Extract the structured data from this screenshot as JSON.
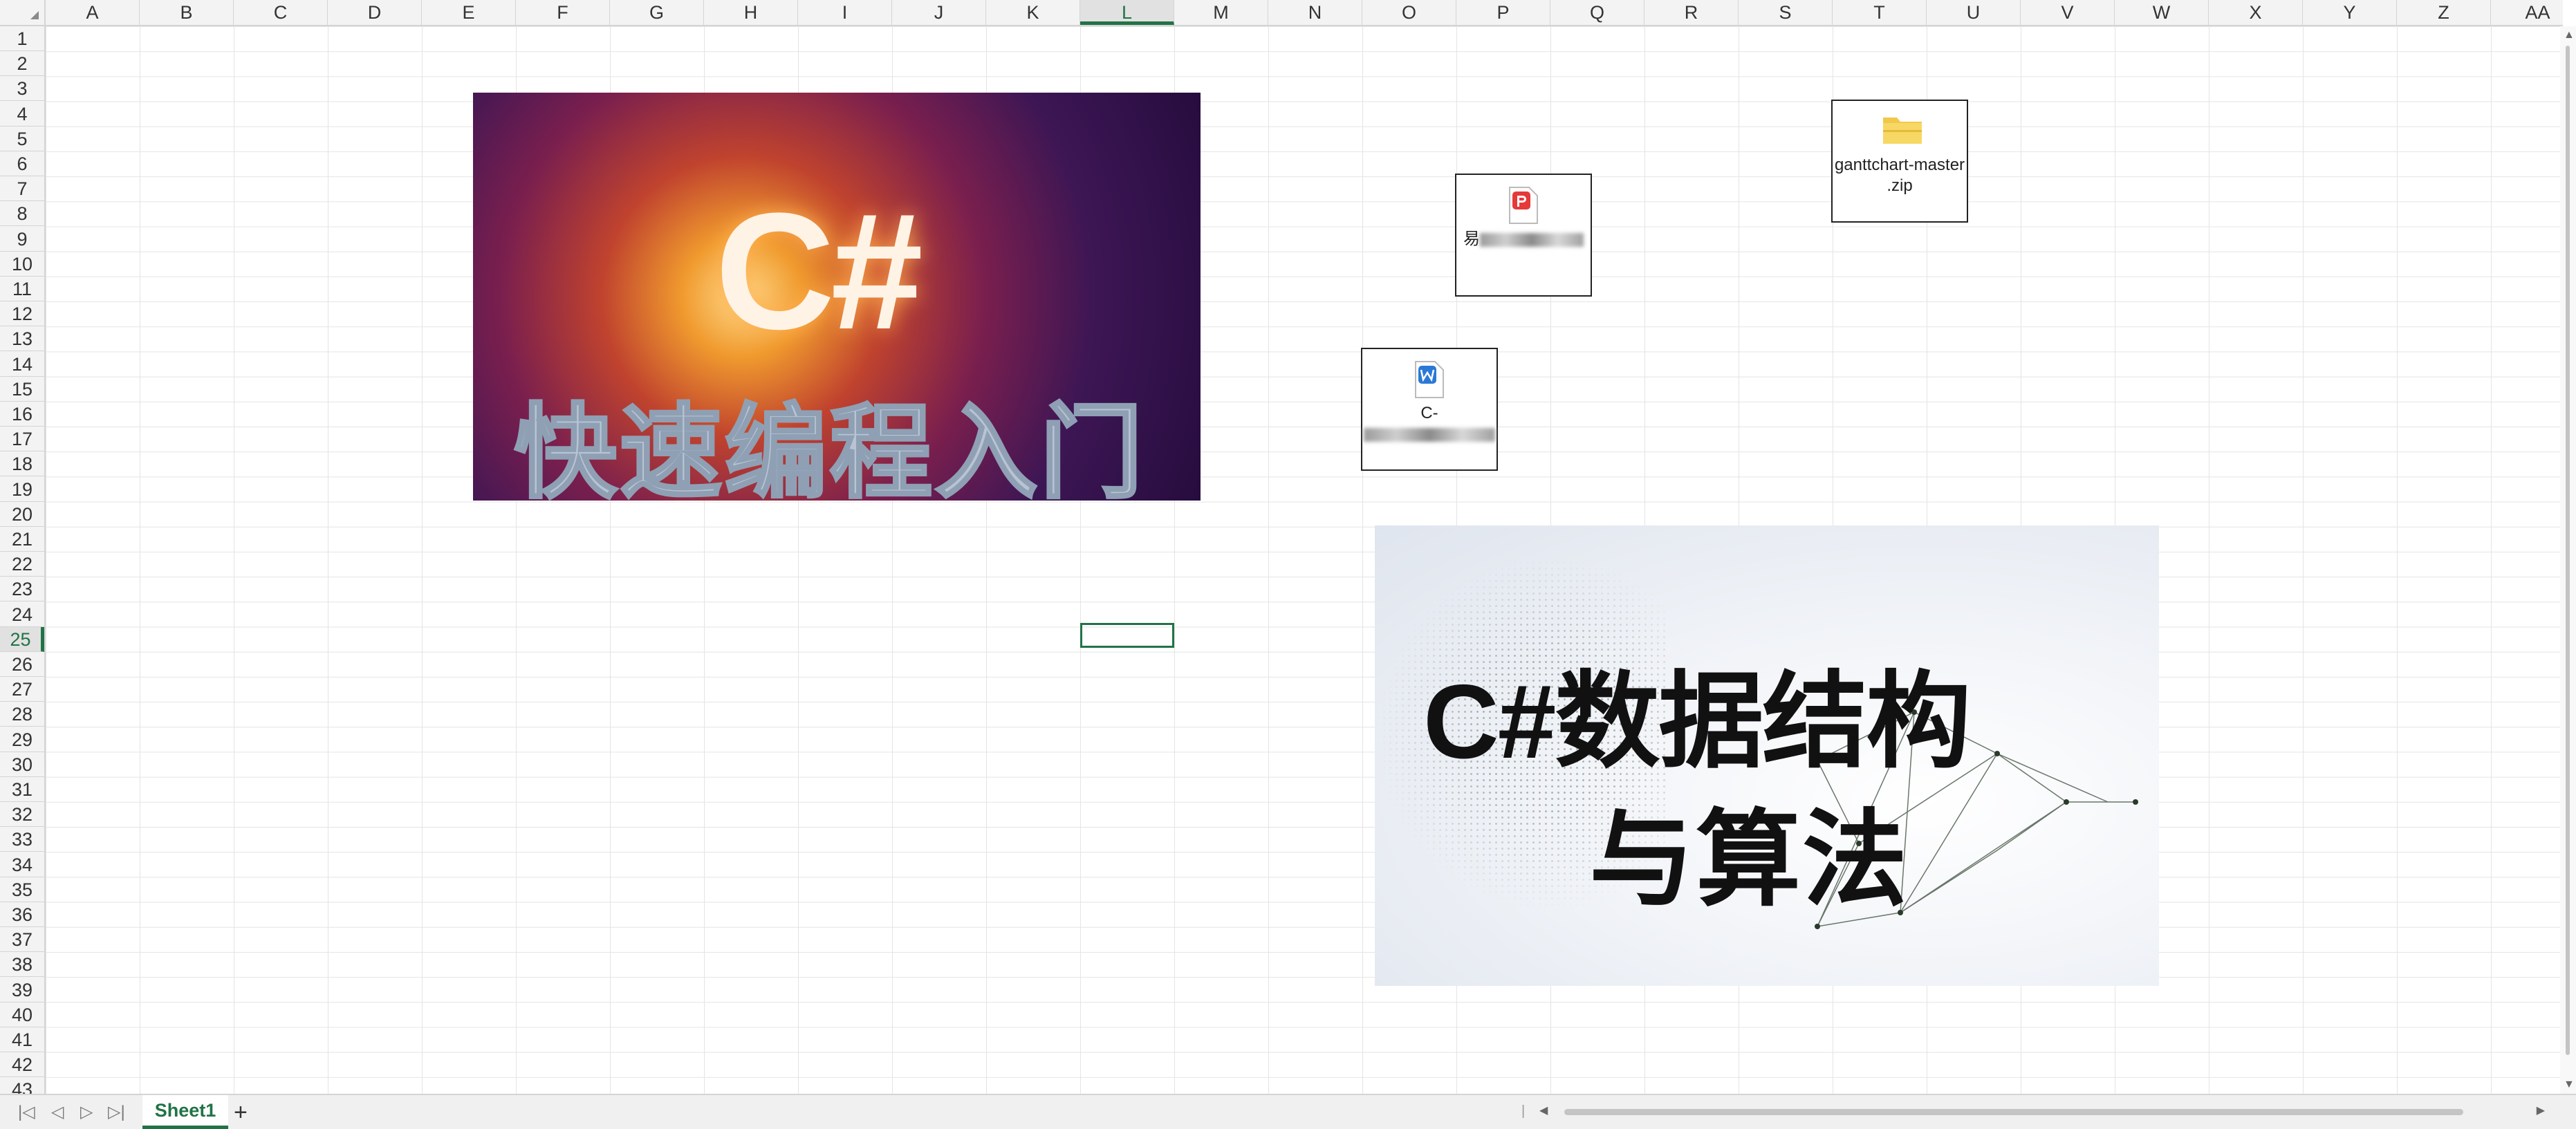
{
  "columns": [
    "A",
    "B",
    "C",
    "D",
    "E",
    "F",
    "G",
    "H",
    "I",
    "J",
    "K",
    "L",
    "M",
    "N",
    "O",
    "P",
    "Q",
    "R",
    "S",
    "T",
    "U",
    "V",
    "W",
    "X",
    "Y",
    "Z",
    "AA"
  ],
  "rows": [
    "1",
    "2",
    "3",
    "4",
    "5",
    "6",
    "7",
    "8",
    "9",
    "10",
    "11",
    "12",
    "13",
    "14",
    "15",
    "16",
    "17",
    "18",
    "19",
    "20",
    "21",
    "22",
    "23",
    "24",
    "25",
    "26",
    "27",
    "28",
    "29",
    "30",
    "31",
    "32",
    "33",
    "34",
    "35",
    "36",
    "37",
    "38",
    "39",
    "40",
    "41",
    "42",
    "43"
  ],
  "active_cell": {
    "column": "L",
    "row": "25"
  },
  "objects": {
    "image_cs": {
      "title": "C#",
      "subtitle": "快速编程入门"
    },
    "image_ds": {
      "line1": "C#数据结构",
      "line2": "与算法"
    },
    "pdf_file": {
      "label_prefix": "易",
      "icon": "pdf-icon"
    },
    "word_file": {
      "label_prefix": "C-",
      "icon": "word-icon"
    },
    "zip_file": {
      "label_line1": "ganttchart-master",
      "label_line2": ".zip",
      "icon": "folder-zip-icon"
    }
  },
  "sheet_tabs": [
    {
      "label": "Sheet1",
      "active": true
    }
  ],
  "add_sheet_label": "+",
  "colors": {
    "accent": "#217346"
  }
}
